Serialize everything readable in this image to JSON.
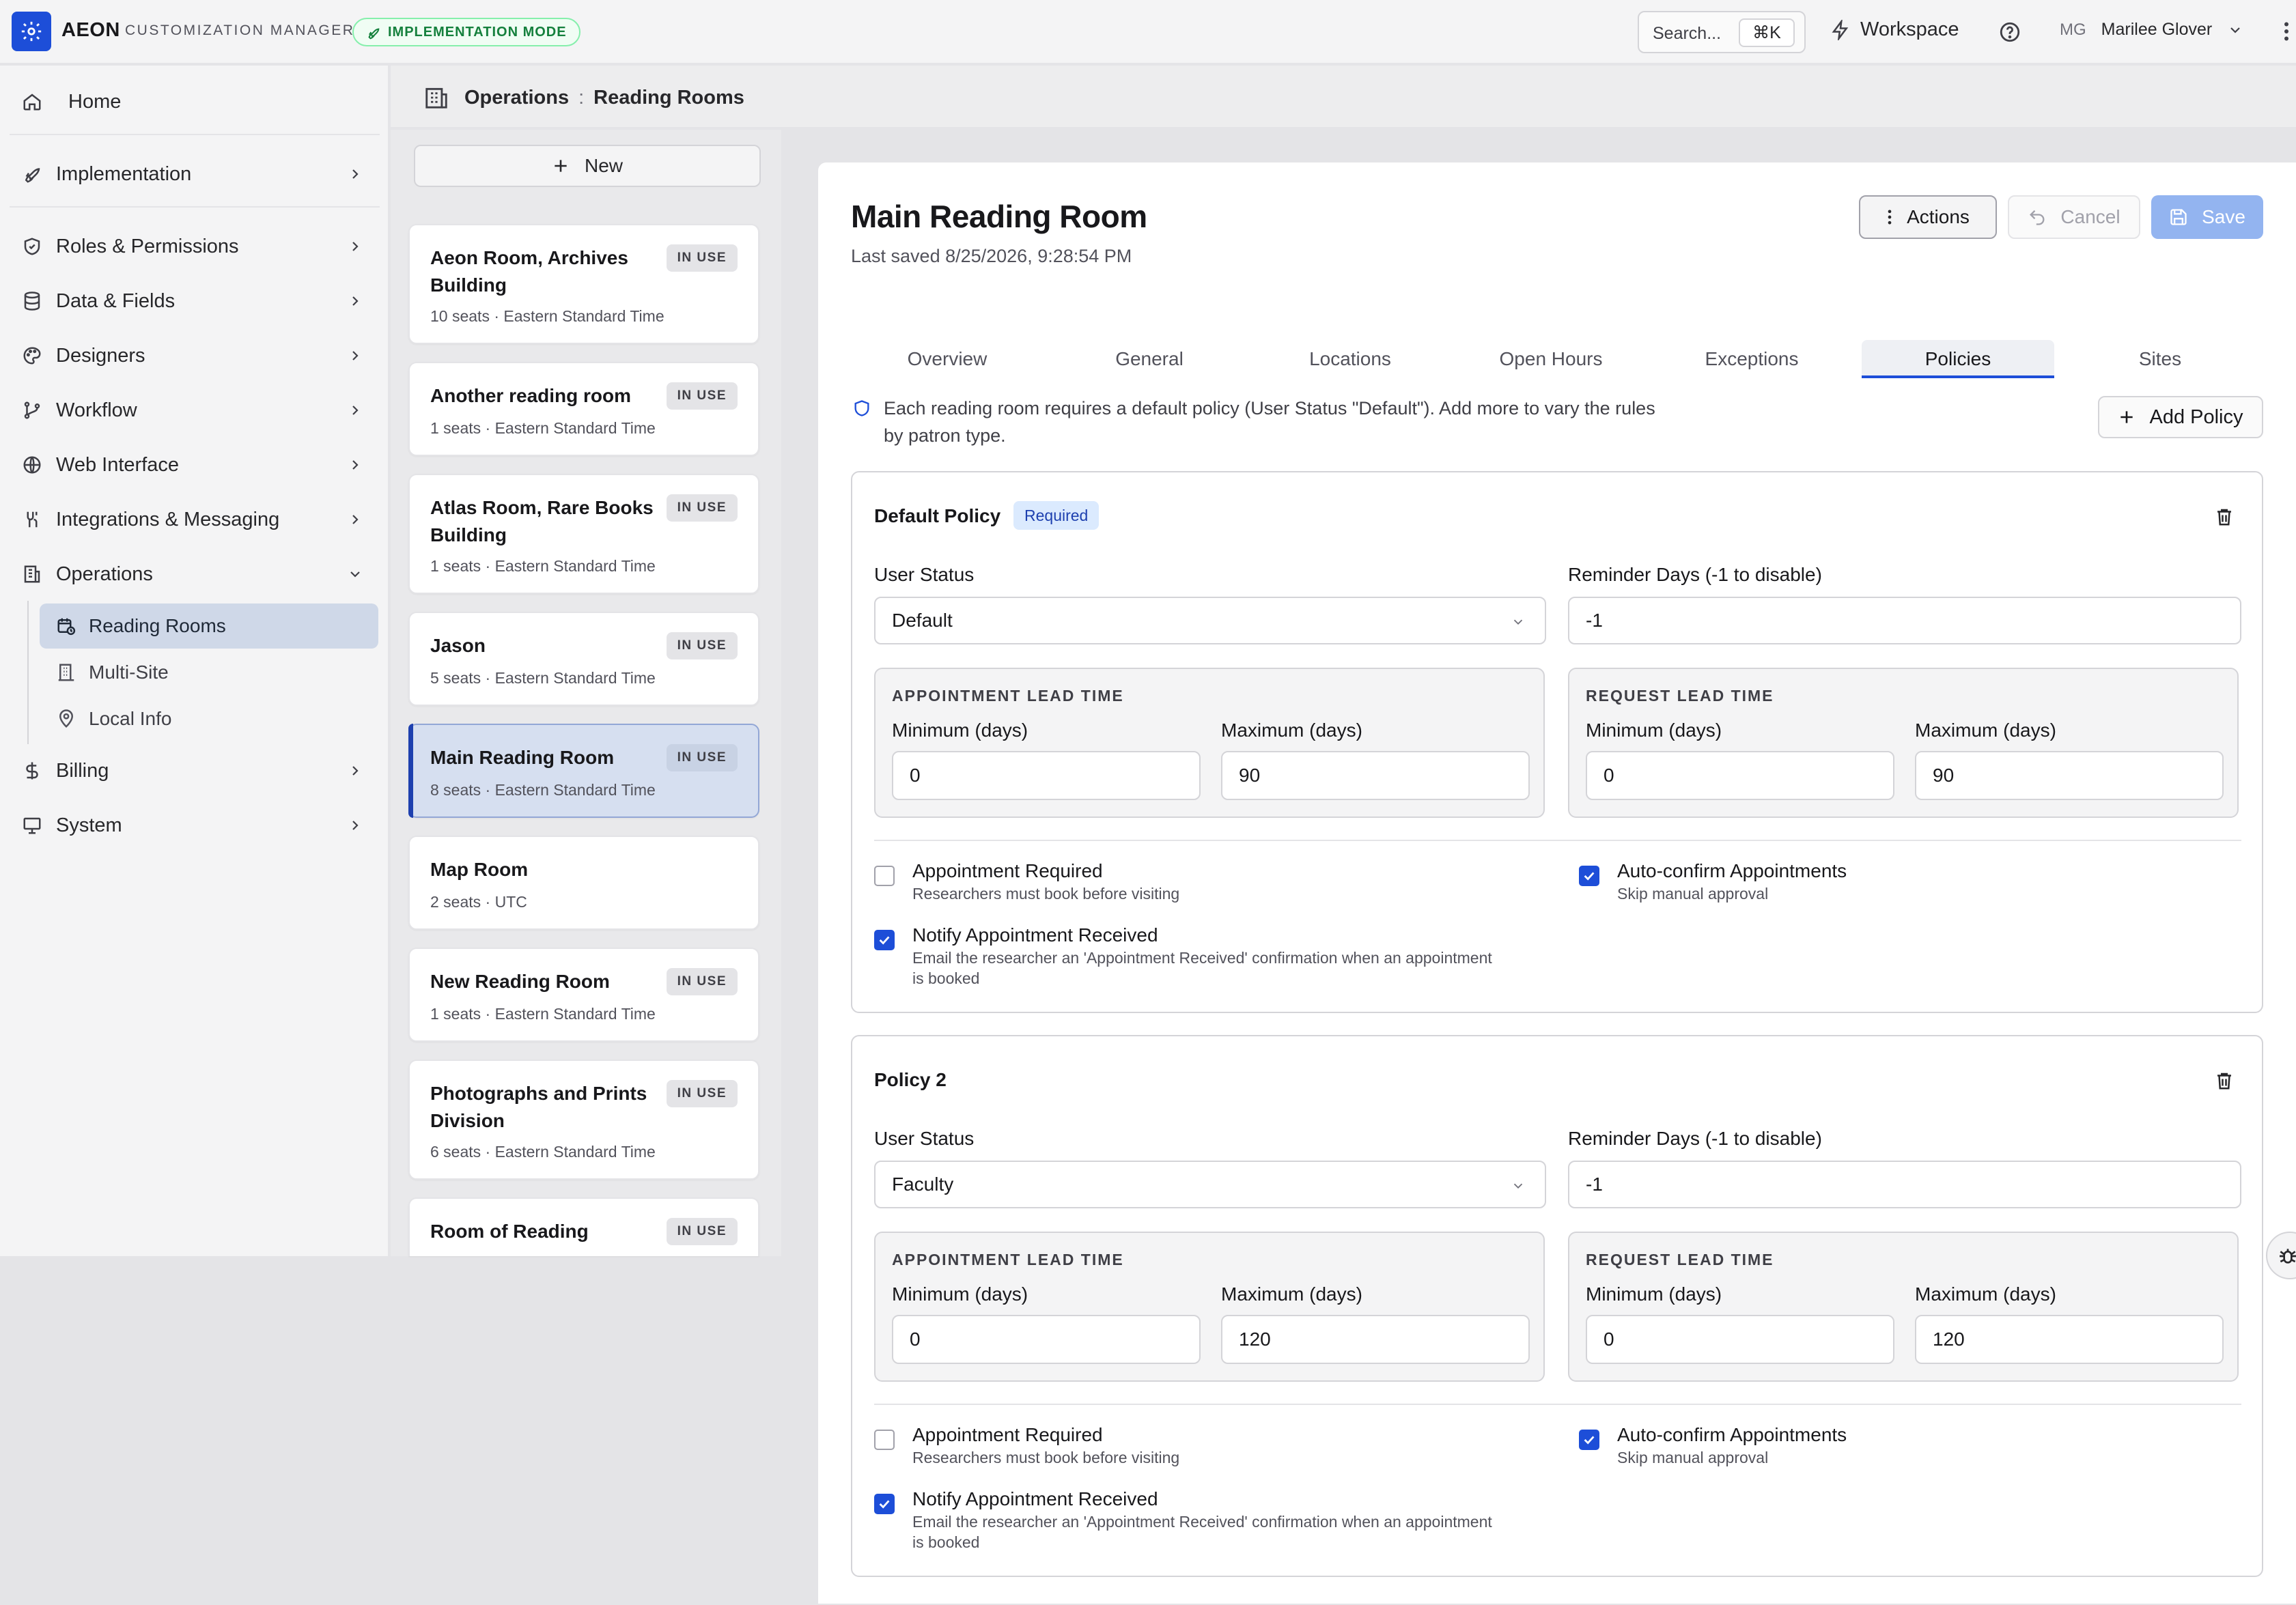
{
  "app": {
    "brand": "AEON",
    "subtitle": "CUSTOMIZATION MANAGER",
    "mode_badge": "IMPLEMENTATION MODE",
    "search_placeholder": "Search...",
    "search_shortcut": "⌘K",
    "workspace_label": "Workspace",
    "user_initials": "MG",
    "user_name": "Marilee Glover"
  },
  "sidebar": {
    "home": "Home",
    "items": [
      {
        "label": "Implementation",
        "icon": "rocket-icon"
      },
      {
        "label": "Roles & Permissions",
        "icon": "shield-icon"
      },
      {
        "label": "Data & Fields",
        "icon": "database-icon"
      },
      {
        "label": "Designers",
        "icon": "palette-icon"
      },
      {
        "label": "Workflow",
        "icon": "workflow-icon"
      },
      {
        "label": "Web Interface",
        "icon": "globe-icon"
      },
      {
        "label": "Integrations & Messaging",
        "icon": "integrations-icon"
      },
      {
        "label": "Operations",
        "icon": "building-icon"
      },
      {
        "label": "Billing",
        "icon": "dollar-icon"
      },
      {
        "label": "System",
        "icon": "monitor-icon"
      }
    ],
    "operations_sub": [
      {
        "label": "Reading Rooms",
        "icon": "calendar-clock-icon",
        "active": true
      },
      {
        "label": "Multi-Site",
        "icon": "buildings-icon",
        "active": false
      },
      {
        "label": "Local Info",
        "icon": "map-pin-icon",
        "active": false
      }
    ]
  },
  "breadcrumb": {
    "section": "Operations",
    "page": "Reading Rooms"
  },
  "list": {
    "new_label": "New",
    "rooms": [
      {
        "name": "Aeon Room, Archives Building",
        "meta": "10 seats · Eastern Standard Time",
        "badge": "IN USE"
      },
      {
        "name": "Another reading room",
        "meta": "1 seats · Eastern Standard Time",
        "badge": "IN USE"
      },
      {
        "name": "Atlas Room, Rare Books Building",
        "meta": "1 seats · Eastern Standard Time",
        "badge": "IN USE"
      },
      {
        "name": "Jason",
        "meta": "5 seats · Eastern Standard Time",
        "badge": "IN USE"
      },
      {
        "name": "Main Reading Room",
        "meta": "8 seats · Eastern Standard Time",
        "badge": "IN USE",
        "active": true
      },
      {
        "name": "Map Room",
        "meta": "2 seats · UTC",
        "badge": ""
      },
      {
        "name": "New Reading Room",
        "meta": "1 seats · Eastern Standard Time",
        "badge": "IN USE"
      },
      {
        "name": "Photographs and Prints Division",
        "meta": "6 seats · Eastern Standard Time",
        "badge": "IN USE"
      },
      {
        "name": "Room of Reading",
        "meta": "",
        "badge": "IN USE"
      }
    ]
  },
  "detail": {
    "title": "Main Reading Room",
    "last_saved": "Last saved 8/25/2026, 9:28:54 PM",
    "actions_label": "Actions",
    "cancel_label": "Cancel",
    "save_label": "Save",
    "tabs": [
      "Overview",
      "General",
      "Locations",
      "Open Hours",
      "Exceptions",
      "Policies",
      "Sites"
    ],
    "active_tab": "Policies",
    "info": "Each reading room requires a default policy (User Status \"Default\"). Add more to vary the rules by patron type.",
    "add_policy_label": "Add Policy",
    "labels": {
      "user_status": "User Status",
      "reminder_days": "Reminder Days (-1 to disable)",
      "appointment_lead": "APPOINTMENT LEAD TIME",
      "request_lead": "REQUEST LEAD TIME",
      "min_days": "Minimum (days)",
      "max_days": "Maximum (days)",
      "appt_required": "Appointment Required",
      "appt_required_desc": "Researchers must book before visiting",
      "auto_confirm": "Auto-confirm Appointments",
      "auto_confirm_desc": "Skip manual approval",
      "notify": "Notify Appointment Received",
      "notify_desc": "Email the researcher an 'Appointment Received' confirmation when an appointment is booked"
    },
    "policies": [
      {
        "name": "Default Policy",
        "required_badge": "Required",
        "user_status": "Default",
        "reminder_days": "-1",
        "appt_min": "0",
        "appt_max": "90",
        "req_min": "0",
        "req_max": "90",
        "appointment_required": false,
        "auto_confirm": true,
        "notify": true
      },
      {
        "name": "Policy 2",
        "required_badge": "",
        "user_status": "Faculty",
        "reminder_days": "-1",
        "appt_min": "0",
        "appt_max": "120",
        "req_min": "0",
        "req_max": "120",
        "appointment_required": false,
        "auto_confirm": true,
        "notify": true
      }
    ]
  }
}
